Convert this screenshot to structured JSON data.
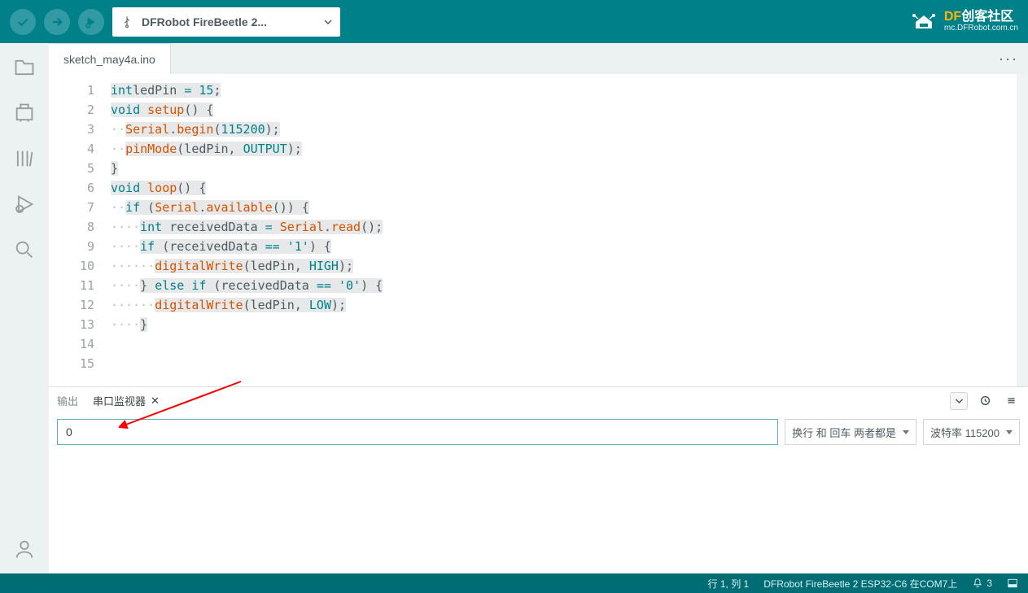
{
  "toolbar": {
    "board_label": "DFRobot FireBeetle 2..."
  },
  "brand": {
    "text1_colored": "DF",
    "text1_rest": "创客社区",
    "sub": "mc.DFRobot.com.cn"
  },
  "tab": {
    "filename": "sketch_may4a.ino"
  },
  "code": {
    "lines": [
      {
        "n": "1",
        "pre": "",
        "tok": [
          [
            "kw",
            "int"
          ],
          [
            "",
            ""
          ],
          [
            "",
            "ledPin"
          ],
          [
            "",
            " "
          ],
          [
            "kw",
            "="
          ],
          [
            "",
            " "
          ],
          [
            "lit",
            "15"
          ],
          [
            "",
            ";"
          ]
        ]
      },
      {
        "n": "2",
        "pre": "",
        "tok": []
      },
      {
        "n": "3",
        "pre": "",
        "tok": [
          [
            "kw",
            "void"
          ],
          [
            "",
            " "
          ],
          [
            "fn",
            "setup"
          ],
          [
            "",
            "()"
          ],
          [
            "",
            " "
          ],
          [
            "",
            "{"
          ]
        ]
      },
      {
        "n": "4",
        "pre": "  ",
        "tok": [
          [
            "fn",
            "Serial"
          ],
          [
            "",
            "."
          ],
          [
            "fn",
            "begin"
          ],
          [
            "",
            "("
          ],
          [
            "lit",
            "115200"
          ],
          [
            "",
            ");"
          ]
        ]
      },
      {
        "n": "5",
        "pre": "  ",
        "tok": [
          [
            "fn",
            "pinMode"
          ],
          [
            "",
            "(ledPin"
          ],
          [
            "",
            ","
          ],
          [
            "",
            " "
          ],
          [
            "lit",
            "OUTPUT"
          ],
          [
            "",
            ");"
          ]
        ]
      },
      {
        "n": "6",
        "pre": "",
        "tok": [
          [
            "",
            "}"
          ]
        ]
      },
      {
        "n": "7",
        "pre": "",
        "tok": []
      },
      {
        "n": "8",
        "pre": "",
        "tok": [
          [
            "kw",
            "void"
          ],
          [
            "",
            " "
          ],
          [
            "fn",
            "loop"
          ],
          [
            "",
            "()"
          ],
          [
            "",
            " "
          ],
          [
            "",
            "{"
          ]
        ]
      },
      {
        "n": "9",
        "pre": "  ",
        "tok": [
          [
            "kw",
            "if"
          ],
          [
            "",
            " ("
          ],
          [
            "fn",
            "Serial"
          ],
          [
            "",
            "."
          ],
          [
            "fn",
            "available"
          ],
          [
            "",
            "())"
          ],
          [
            "",
            " "
          ],
          [
            "",
            "{"
          ]
        ]
      },
      {
        "n": "10",
        "pre": "    ",
        "tok": [
          [
            "kw",
            "int"
          ],
          [
            "",
            " receivedData"
          ],
          [
            "",
            " "
          ],
          [
            "kw",
            "="
          ],
          [
            "",
            " "
          ],
          [
            "fn",
            "Serial"
          ],
          [
            "",
            "."
          ],
          [
            "fn",
            "read"
          ],
          [
            "",
            "();"
          ]
        ]
      },
      {
        "n": "11",
        "pre": "    ",
        "tok": [
          [
            "kw",
            "if"
          ],
          [
            "",
            " (receivedData"
          ],
          [
            "",
            " "
          ],
          [
            "kw",
            "=="
          ],
          [
            "",
            " "
          ],
          [
            "str",
            "'1'"
          ],
          [
            "",
            ")"
          ],
          [
            "",
            " "
          ],
          [
            "",
            "{"
          ]
        ]
      },
      {
        "n": "12",
        "pre": "      ",
        "tok": [
          [
            "fn",
            "digitalWrite"
          ],
          [
            "",
            "(ledPin"
          ],
          [
            "",
            ","
          ],
          [
            "",
            " "
          ],
          [
            "lit",
            "HIGH"
          ],
          [
            "",
            ");"
          ]
        ]
      },
      {
        "n": "13",
        "pre": "    ",
        "tok": [
          [
            "",
            "}"
          ],
          [
            "",
            " "
          ],
          [
            "kw",
            "else"
          ],
          [
            "",
            " "
          ],
          [
            "kw",
            "if"
          ],
          [
            "",
            " (receivedData"
          ],
          [
            "",
            " "
          ],
          [
            "kw",
            "=="
          ],
          [
            "",
            " "
          ],
          [
            "str",
            "'0'"
          ],
          [
            "",
            ")"
          ],
          [
            "",
            " "
          ],
          [
            "",
            "{"
          ]
        ]
      },
      {
        "n": "14",
        "pre": "      ",
        "tok": [
          [
            "fn",
            "digitalWrite"
          ],
          [
            "",
            "(ledPin"
          ],
          [
            "",
            ","
          ],
          [
            "",
            " "
          ],
          [
            "lit",
            "LOW"
          ],
          [
            "",
            ");"
          ]
        ]
      },
      {
        "n": "15",
        "pre": "    ",
        "tok": [
          [
            "",
            "}"
          ]
        ]
      }
    ]
  },
  "panel": {
    "output_label": "输出",
    "monitor_label": "串口监视器"
  },
  "monitor": {
    "input_value": "0",
    "ending_label": "换行 和 回车 两者都是",
    "baud_label": "波特率 115200"
  },
  "status": {
    "cursor": "行 1, 列 1",
    "board": "DFRobot FireBeetle 2 ESP32-C6 在COM7上",
    "notif_count": "3"
  }
}
